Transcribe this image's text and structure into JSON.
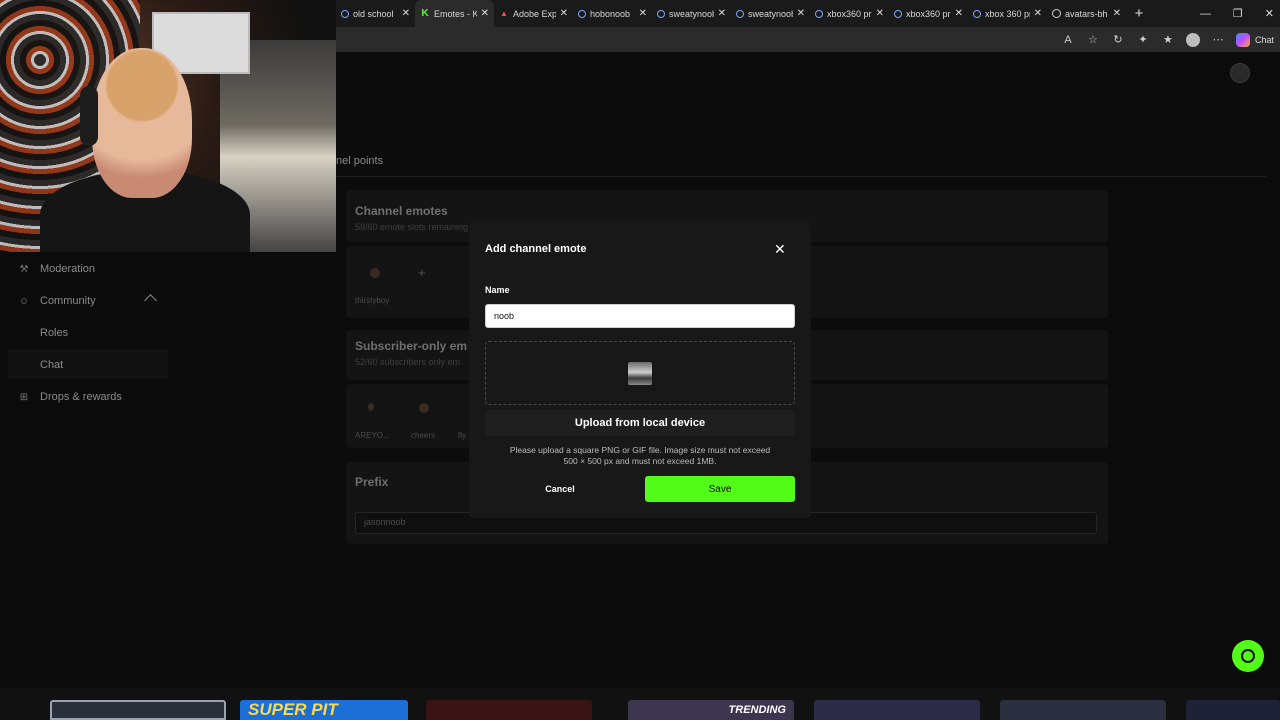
{
  "browser": {
    "tabs": [
      {
        "title": "old school",
        "icon": "search"
      },
      {
        "title": "Emotes - K",
        "icon": "kick",
        "active": true
      },
      {
        "title": "Adobe Expr",
        "icon": "adobe"
      },
      {
        "title": "hobonoob",
        "icon": "search"
      },
      {
        "title": "sweatynoob",
        "icon": "search"
      },
      {
        "title": "sweatynoob",
        "icon": "search"
      },
      {
        "title": "xbox360 pr",
        "icon": "search"
      },
      {
        "title": "xbox360 pr",
        "icon": "search"
      },
      {
        "title": "xbox 360 pr",
        "icon": "search"
      },
      {
        "title": "avatars-bh",
        "icon": "globe"
      }
    ],
    "chat_label": "Chat"
  },
  "sidebar": {
    "items": [
      {
        "label": "Moderation"
      },
      {
        "label": "Community"
      },
      {
        "label": "Roles"
      },
      {
        "label": "Chat"
      },
      {
        "label": "Drops & rewards"
      }
    ]
  },
  "main": {
    "channel_points_partial": "nel points",
    "channel_emotes": {
      "title": "Channel emotes",
      "subtitle": "59/60 emote slots remaining",
      "emote_name": "thirstyboy"
    },
    "subscriber_emotes": {
      "title": "Subscriber-only em",
      "subtitle": "52/60 subscribers only em",
      "emote_names": [
        "AREYO...",
        "cheers",
        "fly"
      ]
    },
    "prefix": {
      "title": "Prefix",
      "value": "jasonnoob"
    }
  },
  "modal": {
    "title": "Add channel emote",
    "name_label": "Name",
    "name_value": "noob",
    "upload_label": "Upload from local device",
    "help_line1": "Please upload a square PNG or GIF file. Image size must not exceed",
    "help_line2": "500 × 500 px and must not exceed 1MB.",
    "cancel_label": "Cancel",
    "save_label": "Save"
  },
  "bottom_strip": {
    "cards": [
      "SUPER PIT",
      "TRENDING"
    ]
  },
  "colors": {
    "accent": "#53fc18",
    "modal_bg": "#181818",
    "page_bg": "#0c0c0c"
  }
}
